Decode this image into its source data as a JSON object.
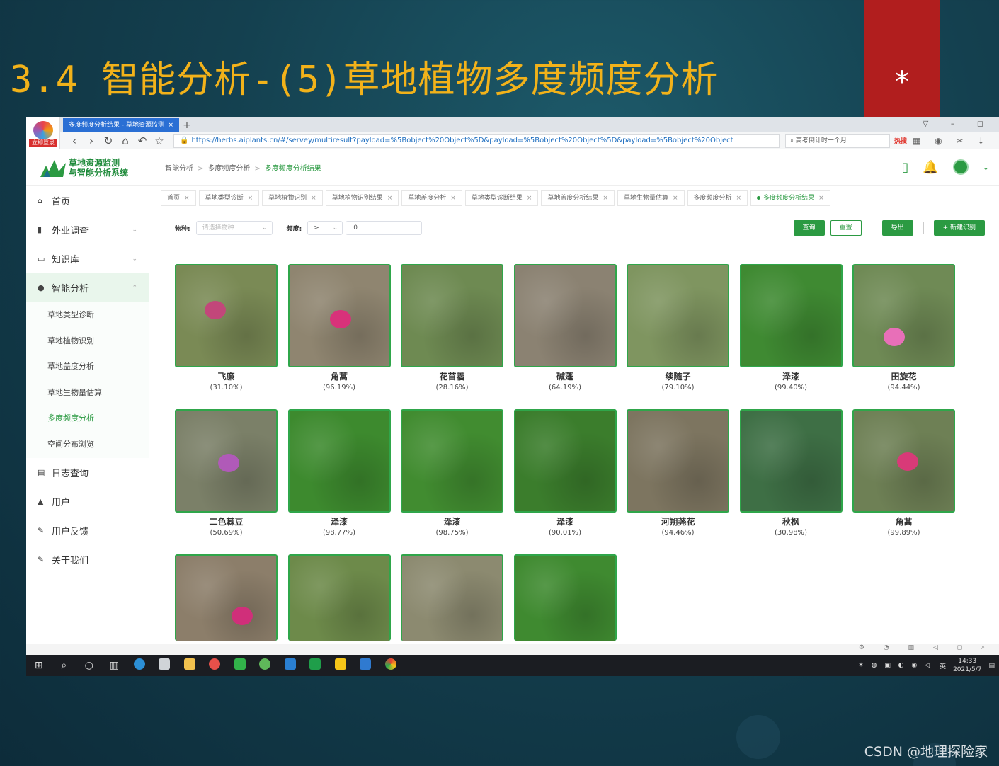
{
  "slide": {
    "title": "3.4  智能分析-(5)草地植物多度频度分析",
    "asterisk": "*",
    "watermark": "CSDN @地理探险家"
  },
  "browser": {
    "badge_label": "立即登录",
    "tab_title": "多度频度分析结果 - 草地资源监测",
    "tab_close": "×",
    "new_tab": "+",
    "url": "https://herbs.aiplants.cn/#/servey/multiresult?payload=%5Bobject%20Object%5D&payload=%5Bobject%20Object%5D&payload=%5Bobject%20Object",
    "search_text": "高考倒计时一个月",
    "hot_label": "热搜"
  },
  "app": {
    "logo_line1": "草地资源监测",
    "logo_line2": "与智能分析系统",
    "breadcrumb": [
      "智能分析",
      "多度频度分析",
      "多度频度分析结果"
    ]
  },
  "sidebar": {
    "items": [
      {
        "label": "首页",
        "icon": "home-icon"
      },
      {
        "label": "外业调查",
        "icon": "bar-chart-icon",
        "chevron": "⌄"
      },
      {
        "label": "知识库",
        "icon": "book-icon",
        "chevron": "⌄"
      },
      {
        "label": "智能分析",
        "icon": "pin-icon",
        "chevron": "⌃"
      }
    ],
    "sub_items": [
      "草地类型诊断",
      "草地植物识别",
      "草地盖度分析",
      "草地生物量估算",
      "多度频度分析",
      "空间分布浏览"
    ],
    "active_sub": "多度频度分析",
    "bottom_items": [
      {
        "label": "日志查询",
        "icon": "log-icon"
      },
      {
        "label": "用户",
        "icon": "user-icon"
      },
      {
        "label": "用户反馈",
        "icon": "feedback-icon"
      },
      {
        "label": "关于我们",
        "icon": "info-icon"
      }
    ]
  },
  "tags": [
    "首页",
    "草地类型诊断",
    "草地植物识别",
    "草地植物识别结果",
    "草地盖度分析",
    "草地类型诊断结果",
    "草地盖度分析结果",
    "草地生物量估算",
    "多度频度分析",
    "多度频度分析结果"
  ],
  "filters": {
    "species_label": "物种:",
    "species_placeholder": "请选择物种",
    "freq_label": "频度:",
    "operator": ">",
    "value": "0"
  },
  "buttons": {
    "query": "查询",
    "reset": "重置",
    "export": "导出",
    "new": "+ 新建识别"
  },
  "results": [
    {
      "name": "飞廉",
      "pct": "(31.10%)",
      "bg": "#7a8a55",
      "bloom": "#c2477a"
    },
    {
      "name": "角蒿",
      "pct": "(96.19%)",
      "bg": "#8f8570",
      "bloom": "#d8327a"
    },
    {
      "name": "花苜蓿",
      "pct": "(28.16%)",
      "bg": "#6e8a52",
      "bloom": ""
    },
    {
      "name": "碱蓬",
      "pct": "(64.19%)",
      "bg": "#8b8272",
      "bloom": ""
    },
    {
      "name": "续随子",
      "pct": "(79.10%)",
      "bg": "#7f9560",
      "bloom": ""
    },
    {
      "name": "泽漆",
      "pct": "(99.40%)",
      "bg": "#3f8a32",
      "bloom": ""
    },
    {
      "name": "田旋花",
      "pct": "(94.44%)",
      "bg": "#6f8a55",
      "bloom": "#e86fb8"
    },
    {
      "name": "二色棘豆",
      "pct": "(50.69%)",
      "bg": "#7b8068",
      "bloom": "#b05ab8"
    },
    {
      "name": "泽漆",
      "pct": "(98.77%)",
      "bg": "#3d8a2e",
      "bloom": ""
    },
    {
      "name": "泽漆",
      "pct": "(98.75%)",
      "bg": "#418c30",
      "bloom": ""
    },
    {
      "name": "泽漆",
      "pct": "(90.01%)",
      "bg": "#3b7d2c",
      "bloom": ""
    },
    {
      "name": "河朔荛花",
      "pct": "(94.46%)",
      "bg": "#7d7560",
      "bloom": ""
    },
    {
      "name": "秋枫",
      "pct": "(30.98%)",
      "bg": "#3e6f45",
      "bloom": ""
    },
    {
      "name": "角蒿",
      "pct": "(99.89%)",
      "bg": "#6e8055",
      "bloom": "#d83a78"
    },
    {
      "name": "",
      "pct": "",
      "bg": "#8c7e6a",
      "bloom": "#d02f7a"
    },
    {
      "name": "",
      "pct": "",
      "bg": "#6d8a4a",
      "bloom": ""
    },
    {
      "name": "",
      "pct": "",
      "bg": "#8c8a70",
      "bloom": ""
    },
    {
      "name": "",
      "pct": "",
      "bg": "#3f8a30",
      "bloom": ""
    }
  ],
  "taskbar": {
    "time": "14:33",
    "date": "2021/5/7",
    "ime": "英"
  }
}
